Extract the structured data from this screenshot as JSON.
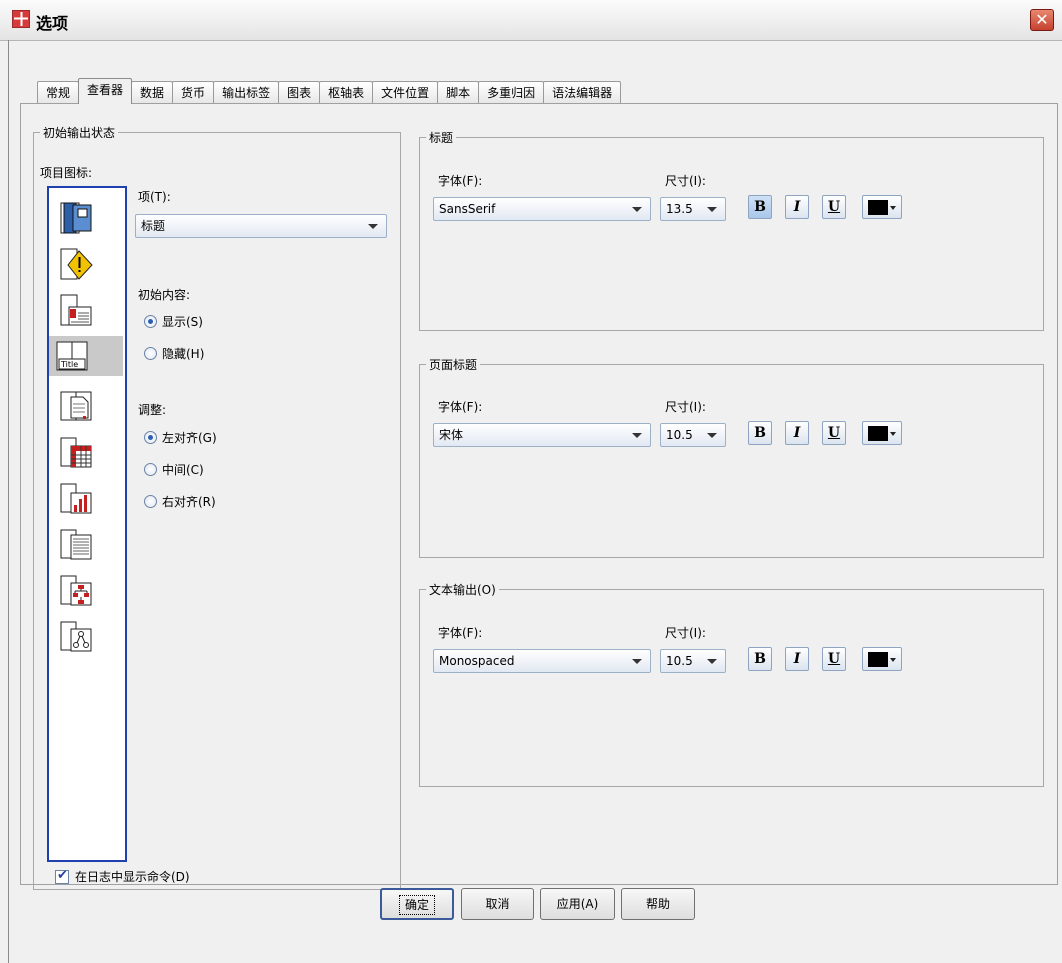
{
  "window": {
    "title": "选项",
    "close_glyph": "✕"
  },
  "tabs": [
    "常规",
    "查看器",
    "数据",
    "货币",
    "输出标签",
    "图表",
    "枢轴表",
    "文件位置",
    "脚本",
    "多重归因",
    "语法编辑器"
  ],
  "active_tab": "查看器",
  "initial_output": {
    "legend": "初始输出状态",
    "item_icons_label": "项目图标:",
    "item_label": "项(T):",
    "item_value": "标题",
    "icons": [
      "log-icon",
      "warning-icon",
      "notes-icon",
      "title-icon",
      "page-title-icon",
      "pivot-table-icon",
      "chart-icon",
      "text-output-icon",
      "tree-model-icon",
      "model-icon"
    ],
    "selected_icon_index": 3,
    "contents_label": "初始内容:",
    "contents_options": [
      "显示(S)",
      "隐藏(H)"
    ],
    "contents_selected": 0,
    "justify_label": "调整:",
    "justify_options": [
      "左对齐(G)",
      "中间(C)",
      "右对齐(R)"
    ],
    "justify_selected": 0,
    "show_commands_label": "在日志中显示命令(D)",
    "show_commands_checked": true
  },
  "font_groups": [
    {
      "legend": "标题",
      "font_label": "字体(F):",
      "font_value": "SansSerif",
      "size_label": "尺寸(I):",
      "size_value": "13.5",
      "bold": "B",
      "italic": "I",
      "underline": "U",
      "color": "#000000"
    },
    {
      "legend": "页面标题",
      "font_label": "字体(F):",
      "font_value": "宋体",
      "size_label": "尺寸(I):",
      "size_value": "10.5",
      "bold": "B",
      "italic": "I",
      "underline": "U",
      "color": "#000000"
    },
    {
      "legend": "文本输出(O)",
      "font_label": "字体(F):",
      "font_value": "Monospaced",
      "size_label": "尺寸(I):",
      "size_value": "10.5",
      "bold": "B",
      "italic": "I",
      "underline": "U",
      "color": "#000000"
    }
  ],
  "buttons": {
    "ok": "确定",
    "cancel": "取消",
    "apply": "应用(A)",
    "help": "帮助"
  }
}
